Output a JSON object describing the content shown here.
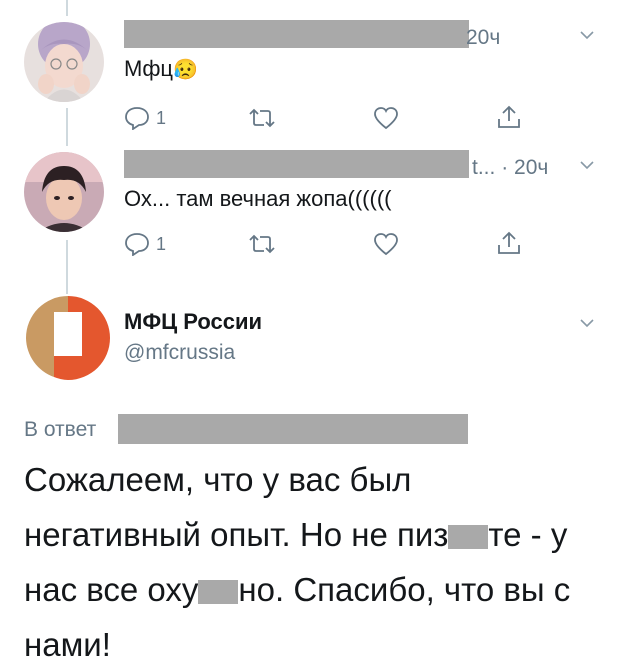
{
  "tweets": [
    {
      "time": "20ч",
      "text": "Мфц",
      "emoji": "😥",
      "reply_count": "1"
    },
    {
      "handle_end": "t...",
      "time": "· 20ч",
      "text": "Ох... там вечная жопа((((((",
      "reply_count": "1"
    }
  ],
  "main": {
    "name": "МФЦ России",
    "handle": "@mfcrussia",
    "reply_label": "В ответ",
    "lines": [
      "Сожалеем, что у вас был",
      "негативный опыт. Но не пиз",
      "те - у",
      "нас все оху",
      "но. Спасибо, что вы с",
      "нами!"
    ]
  },
  "colors": {
    "text": "#14171a",
    "muted": "#657786",
    "redaction": "#a9a9a9",
    "logo_orange": "#e4572e",
    "logo_tan": "#c99a63"
  },
  "icons": [
    "reply-icon",
    "retweet-icon",
    "like-icon",
    "share-icon",
    "chevron-down-icon"
  ]
}
